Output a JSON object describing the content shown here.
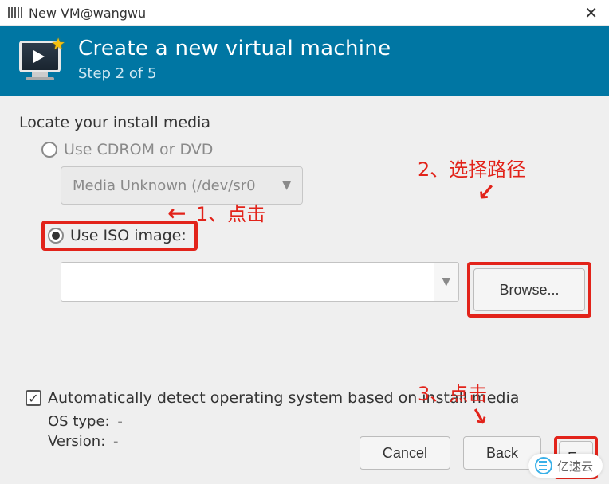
{
  "titlebar": {
    "title": "New VM@wangwu"
  },
  "header": {
    "title": "Create a new virtual machine",
    "step": "Step 2 of 5"
  },
  "section_label": "Locate your install media",
  "option_cdrom": {
    "label": "Use CDROM or DVD",
    "media": "Media Unknown (/dev/sr0"
  },
  "option_iso": {
    "label": "Use ISO image:",
    "value": "",
    "browse": "Browse..."
  },
  "autodetect": {
    "label": "Automatically detect operating system based on install media",
    "os_type_label": "OS type:",
    "os_type_value": "-",
    "version_label": "Version:",
    "version_value": "-"
  },
  "buttons": {
    "cancel": "Cancel",
    "back": "Back",
    "forward": "Fo"
  },
  "annotations": {
    "n1": "1)",
    "n2": "2)",
    "n3": "3)",
    "click1": "1、点击",
    "path2": "2、选择路径",
    "click3": "3、点击"
  },
  "watermark": "亿速云"
}
